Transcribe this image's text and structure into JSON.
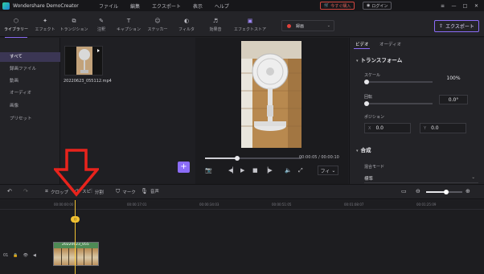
{
  "app": {
    "title": "Wondershare DemoCreator"
  },
  "menu": [
    "ファイル",
    "編集",
    "エクスポート",
    "表示",
    "ヘルプ"
  ],
  "titlebar": {
    "buy_label": "今すぐ購入",
    "login_label": "ログイン"
  },
  "toolbar": {
    "tabs": [
      {
        "label": "ライブラリー",
        "icon": "library-icon"
      },
      {
        "label": "エフェクト",
        "icon": "effects-icon"
      },
      {
        "label": "トランジション",
        "icon": "transition-icon"
      },
      {
        "label": "注釈",
        "icon": "annotation-icon"
      },
      {
        "label": "キャプション",
        "icon": "caption-icon"
      },
      {
        "label": "ステッカー",
        "icon": "sticker-icon"
      },
      {
        "label": "フィルタ",
        "icon": "filter-icon"
      },
      {
        "label": "効果音",
        "icon": "sound-effect-icon"
      },
      {
        "label": "エフェクトストア",
        "icon": "store-icon"
      }
    ],
    "record_label": "録画",
    "export_label": "エクスポート"
  },
  "sidebar": {
    "items": [
      "すべて",
      "録画ファイル",
      "動画",
      "オーディオ",
      "画像",
      "プリセット"
    ]
  },
  "media": {
    "file_name": "20220623_055112.mp4"
  },
  "preview": {
    "time_current": "00:00:05",
    "time_total": "00:00:10",
    "fit_label": "フィ",
    "progress": 0.33
  },
  "properties": {
    "tabs": [
      "ビデオ",
      "オーディオ"
    ],
    "transform_title": "トランスフォーム",
    "scale_label": "スケール",
    "scale_value": "100%",
    "rotate_label": "回転",
    "rotate_value": "0.0°",
    "position_label": "ポジション",
    "pos_x_axis": "X",
    "pos_x": "0.0",
    "pos_y_axis": "Y",
    "pos_y": "0.0",
    "composite_title": "合成",
    "blend_label": "混合モード",
    "blend_value": "標準"
  },
  "edit_toolbar": {
    "crop": "クロップ",
    "speed": "スピ",
    "split": "分割",
    "marker": "マーク",
    "audio": "音声"
  },
  "timeline": {
    "ticks": [
      "00:00:00:00",
      "00:00:17:01",
      "00:00:34:03",
      "00:00:51:05",
      "00:01:08:07",
      "00:01:25:09"
    ],
    "clip_name": "20220623_055",
    "track_number": "01"
  },
  "colors": {
    "accent": "#8b6cf7",
    "playhead": "#f2c232",
    "record": "#e0413b",
    "annotation": "#e8231c"
  }
}
